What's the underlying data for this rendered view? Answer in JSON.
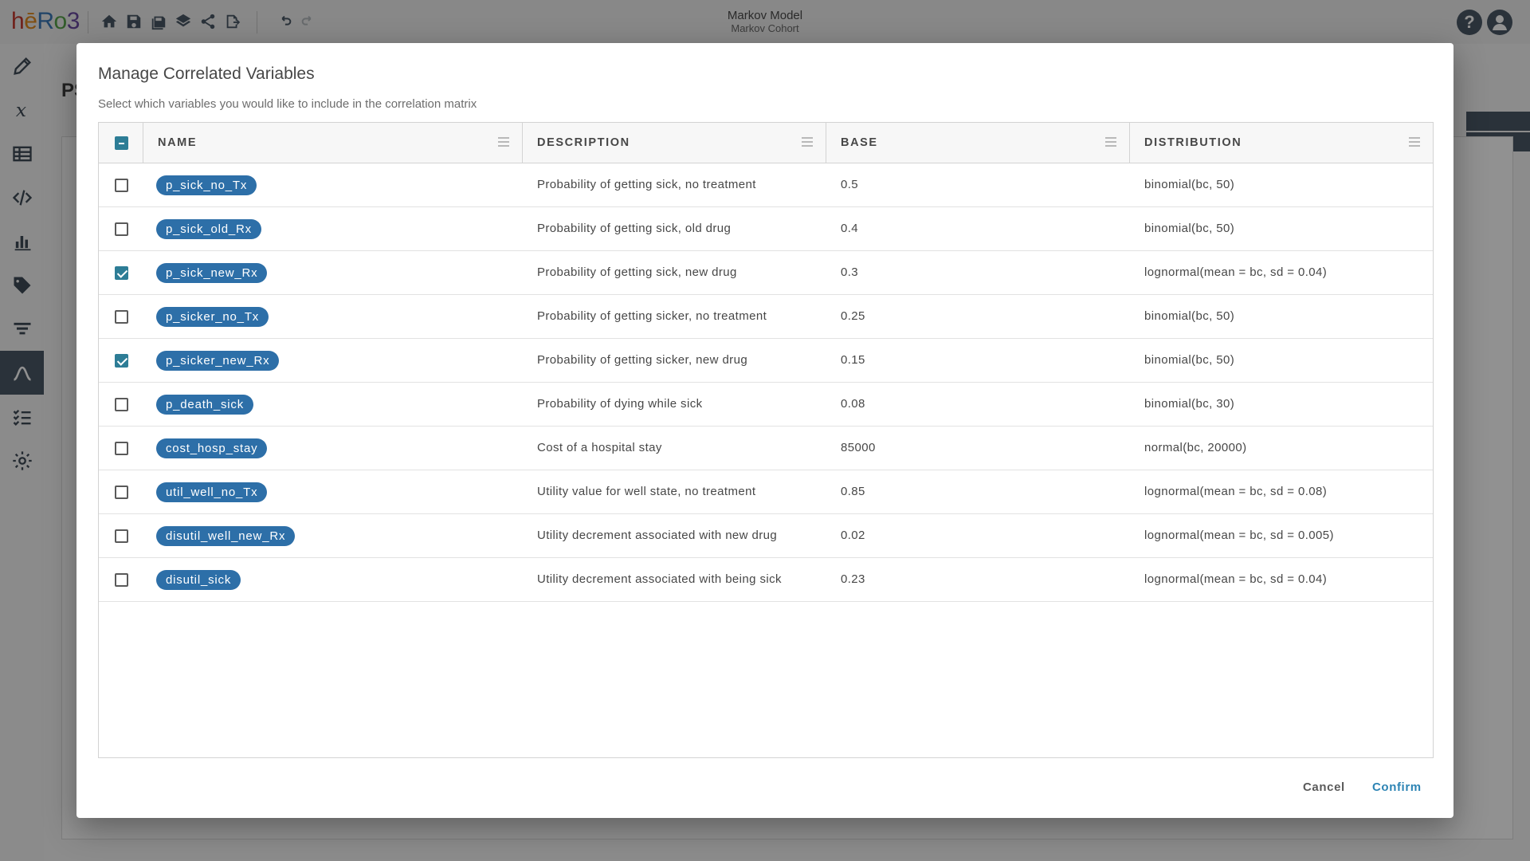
{
  "app": {
    "title": "Markov Model",
    "subtitle": "Markov Cohort",
    "logo": {
      "h": "h",
      "e": "ē",
      "r": "R",
      "o": "o",
      "n": "3"
    },
    "toolbar_icons": [
      "home-icon",
      "save-icon",
      "save-as-icon",
      "layers-icon",
      "share-icon",
      "export-icon",
      "undo-icon",
      "redo-icon"
    ],
    "right_icons": {
      "help": "?",
      "user": "user-icon"
    },
    "sidebar_icons": [
      "pencil-icon",
      "variable-x-icon",
      "table-icon",
      "code-icon",
      "bar-chart-icon",
      "tag-icon",
      "filter-icon",
      "distribution-icon",
      "checklist-icon",
      "gear-icon"
    ],
    "background_title": "PS"
  },
  "modal": {
    "title": "Manage Correlated Variables",
    "subtitle": "Select which variables you would like to include in the correlation matrix",
    "columns": [
      "NAME",
      "DESCRIPTION",
      "BASE",
      "DISTRIBUTION"
    ],
    "rows": [
      {
        "name": "p_sick_no_Tx",
        "description": "Probability of getting sick, no treatment",
        "base": "0.5",
        "distribution": "binomial(bc, 50)",
        "checked": false
      },
      {
        "name": "p_sick_old_Rx",
        "description": "Probability of getting sick, old drug",
        "base": "0.4",
        "distribution": "binomial(bc, 50)",
        "checked": false
      },
      {
        "name": "p_sick_new_Rx",
        "description": "Probability of getting sick, new drug",
        "base": "0.3",
        "distribution": "lognormal(mean = bc, sd = 0.04)",
        "checked": true
      },
      {
        "name": "p_sicker_no_Tx",
        "description": "Probability of getting sicker, no treatment",
        "base": "0.25",
        "distribution": "binomial(bc, 50)",
        "checked": false
      },
      {
        "name": "p_sicker_new_Rx",
        "description": "Probability of getting sicker, new drug",
        "base": "0.15",
        "distribution": "binomial(bc, 50)",
        "checked": true
      },
      {
        "name": "p_death_sick",
        "description": "Probability of dying while sick",
        "base": "0.08",
        "distribution": "binomial(bc, 30)",
        "checked": false
      },
      {
        "name": "cost_hosp_stay",
        "description": "Cost of a hospital stay",
        "base": "85000",
        "distribution": "normal(bc, 20000)",
        "checked": false
      },
      {
        "name": "util_well_no_Tx",
        "description": "Utility value for well state, no treatment",
        "base": "0.85",
        "distribution": "lognormal(mean = bc, sd = 0.08)",
        "checked": false
      },
      {
        "name": "disutil_well_new_Rx",
        "description": "Utility decrement associated with new drug",
        "base": "0.02",
        "distribution": "lognormal(mean = bc, sd = 0.005)",
        "checked": false
      },
      {
        "name": "disutil_sick",
        "description": "Utility decrement associated with being sick",
        "base": "0.23",
        "distribution": "lognormal(mean = bc, sd = 0.04)",
        "checked": false
      }
    ],
    "cancel_label": "Cancel",
    "confirm_label": "Confirm",
    "colors": {
      "pill": "#2d6fa8",
      "check": "#2d7d96",
      "confirm": "#2d84b4"
    }
  }
}
